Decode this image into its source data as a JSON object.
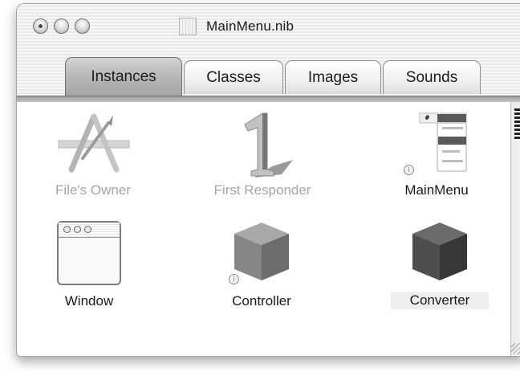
{
  "window": {
    "title": "MainMenu.nib"
  },
  "tabs": [
    {
      "label": "Instances",
      "active": true
    },
    {
      "label": "Classes",
      "active": false
    },
    {
      "label": "Images",
      "active": false
    },
    {
      "label": "Sounds",
      "active": false
    }
  ],
  "instances": [
    {
      "label": "File's Owner",
      "icon": "app-tools-icon",
      "dimmed": true
    },
    {
      "label": "First Responder",
      "icon": "first-responder-icon",
      "dimmed": true
    },
    {
      "label": "MainMenu",
      "icon": "menu-icon",
      "dimmed": false,
      "badge": true
    },
    {
      "label": "Window",
      "icon": "window-icon",
      "dimmed": false
    },
    {
      "label": "Controller",
      "icon": "cube-icon",
      "dimmed": false,
      "badge": true
    },
    {
      "label": "Converter",
      "icon": "cube-icon",
      "dimmed": false,
      "selected": true
    }
  ],
  "colors": {
    "cube_light": "#8f8f8f",
    "cube_dark": "#4f4f4f",
    "dimmed_text": "#a5a5a5"
  }
}
